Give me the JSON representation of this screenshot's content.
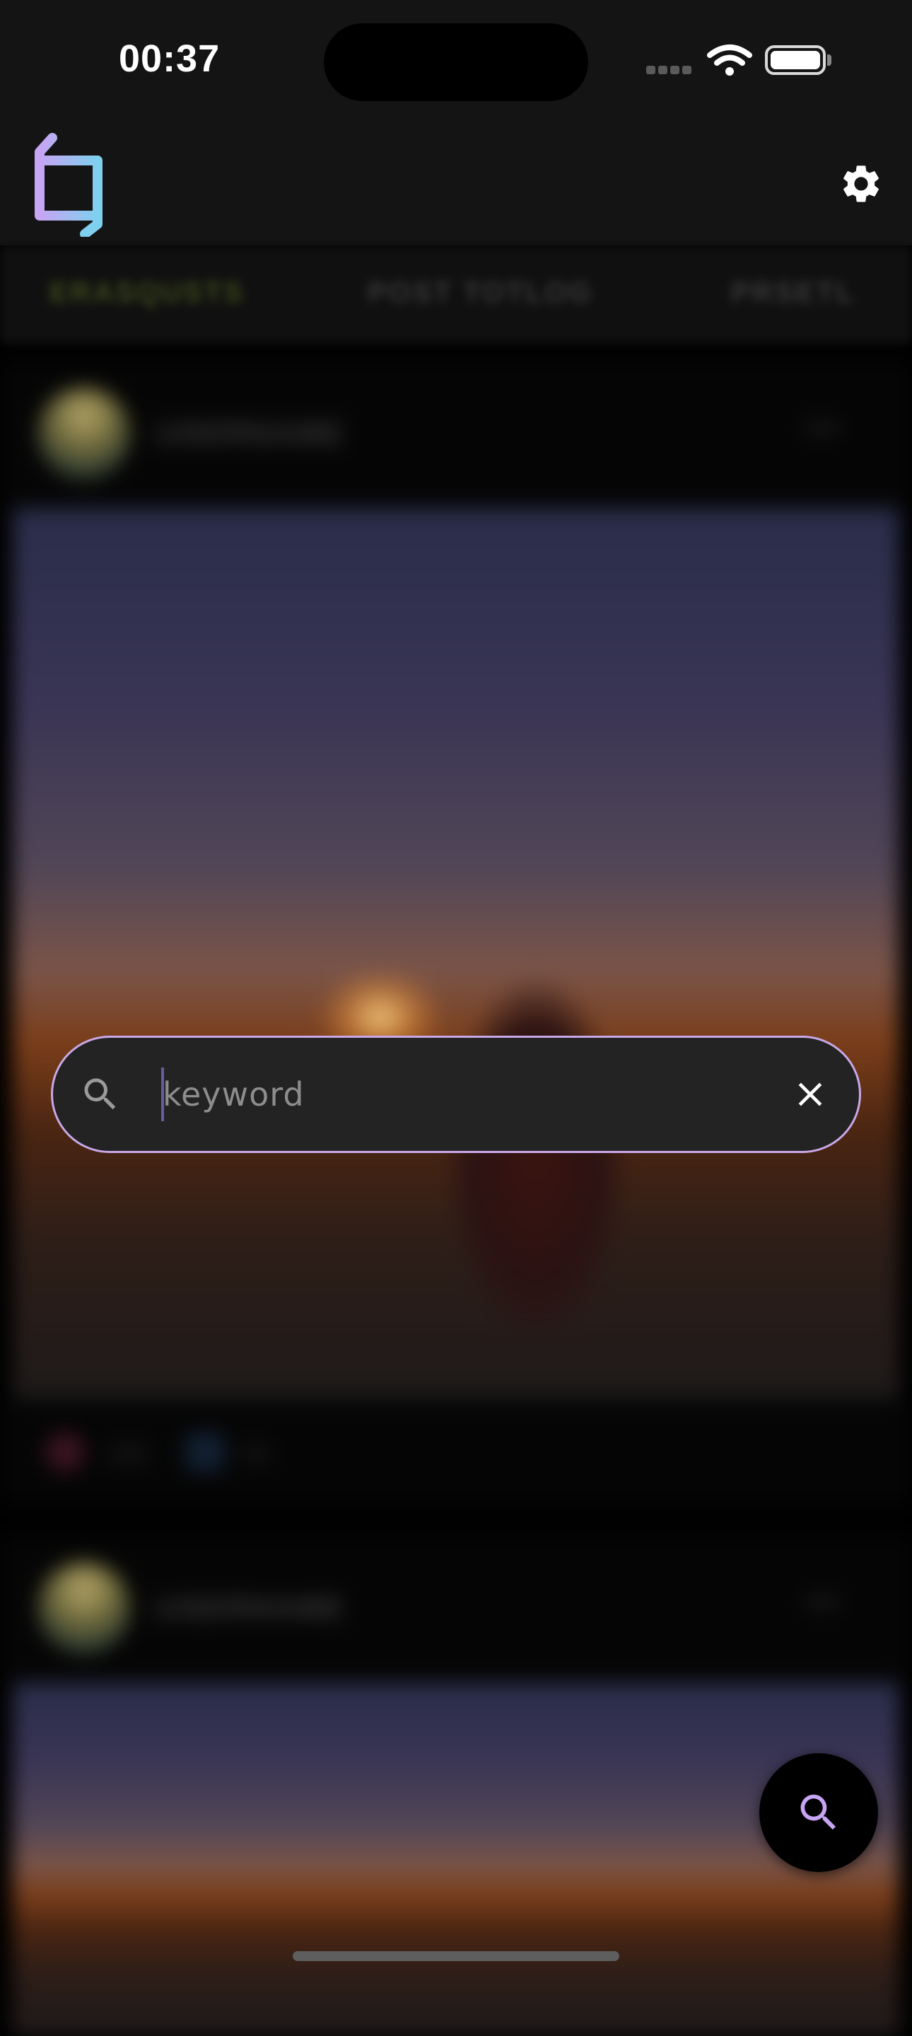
{
  "status_bar": {
    "time": "00:37"
  },
  "tabs": [
    {
      "label": "ERASQUSTS",
      "active": true
    },
    {
      "label": "POST TOTLOG",
      "active": false
    },
    {
      "label": "PRSETL",
      "active": false
    }
  ],
  "posts": [
    {
      "username": "USERNAME",
      "likes": "126",
      "comments": "24"
    },
    {
      "username": "USERNAME"
    }
  ],
  "search": {
    "placeholder": "keyword",
    "value": ""
  },
  "colors": {
    "accent": "#c9a8e8",
    "logo_purple": "#c7a4f4",
    "logo_blue": "#7fd0ee"
  },
  "icons": [
    "logo-icon",
    "gear-icon",
    "search-icon",
    "close-icon",
    "heart-icon",
    "comment-icon"
  ]
}
